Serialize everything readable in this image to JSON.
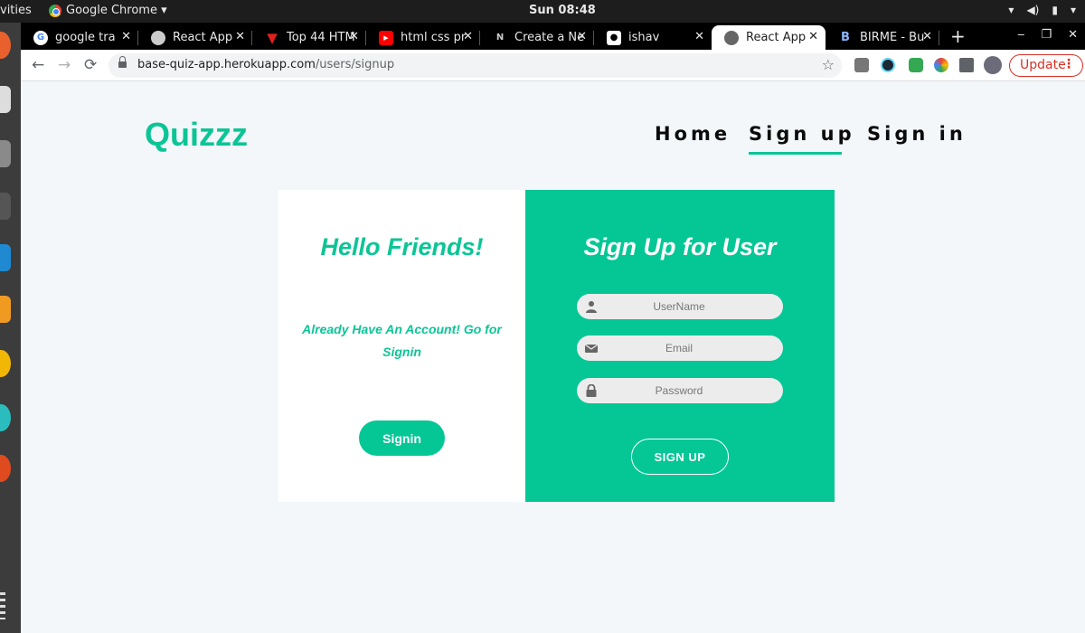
{
  "os": {
    "activities": "vities",
    "app_menu": "Google Chrome ▾",
    "clock": "Sun 08:48",
    "tray": [
      "▾",
      "◀)",
      "▮",
      "▾"
    ]
  },
  "browser": {
    "tabs": [
      {
        "title": "google tra",
        "close": "✕"
      },
      {
        "title": "React App",
        "close": "✕"
      },
      {
        "title": "Top 44 HTM",
        "close": "✕"
      },
      {
        "title": "html css pr",
        "close": "✕"
      },
      {
        "title": "Create a Ne",
        "close": "✕"
      },
      {
        "title": "ishav",
        "close": "✕"
      },
      {
        "title": "React App",
        "close": "✕"
      },
      {
        "title": "BIRME - Bu",
        "close": "✕"
      }
    ],
    "new_tab": "+",
    "window_controls": [
      "‒",
      "❐",
      "✕"
    ],
    "back": "←",
    "forward": "→",
    "reload": "⟳",
    "url_host": "base-quiz-app.herokuapp.com",
    "url_path": "/users/signup",
    "star": "☆",
    "update_label": "Update",
    "kebab": "⋮"
  },
  "site": {
    "logo": "Quizzz",
    "nav": {
      "home": "Home",
      "signup": "Sign up",
      "signin": "Sign in"
    },
    "left_panel": {
      "heading": "Hello Friends!",
      "message": "Already Have An Account! Go for Signin",
      "button": "Signin"
    },
    "right_panel": {
      "heading": "Sign Up for User",
      "username_placeholder": "UserName",
      "email_placeholder": "Email",
      "password_placeholder": "Password",
      "button": "SIGN UP"
    }
  },
  "colors": {
    "accent": "#0cc596",
    "panel": "#04c795",
    "page_bg": "#f3f7fa"
  }
}
